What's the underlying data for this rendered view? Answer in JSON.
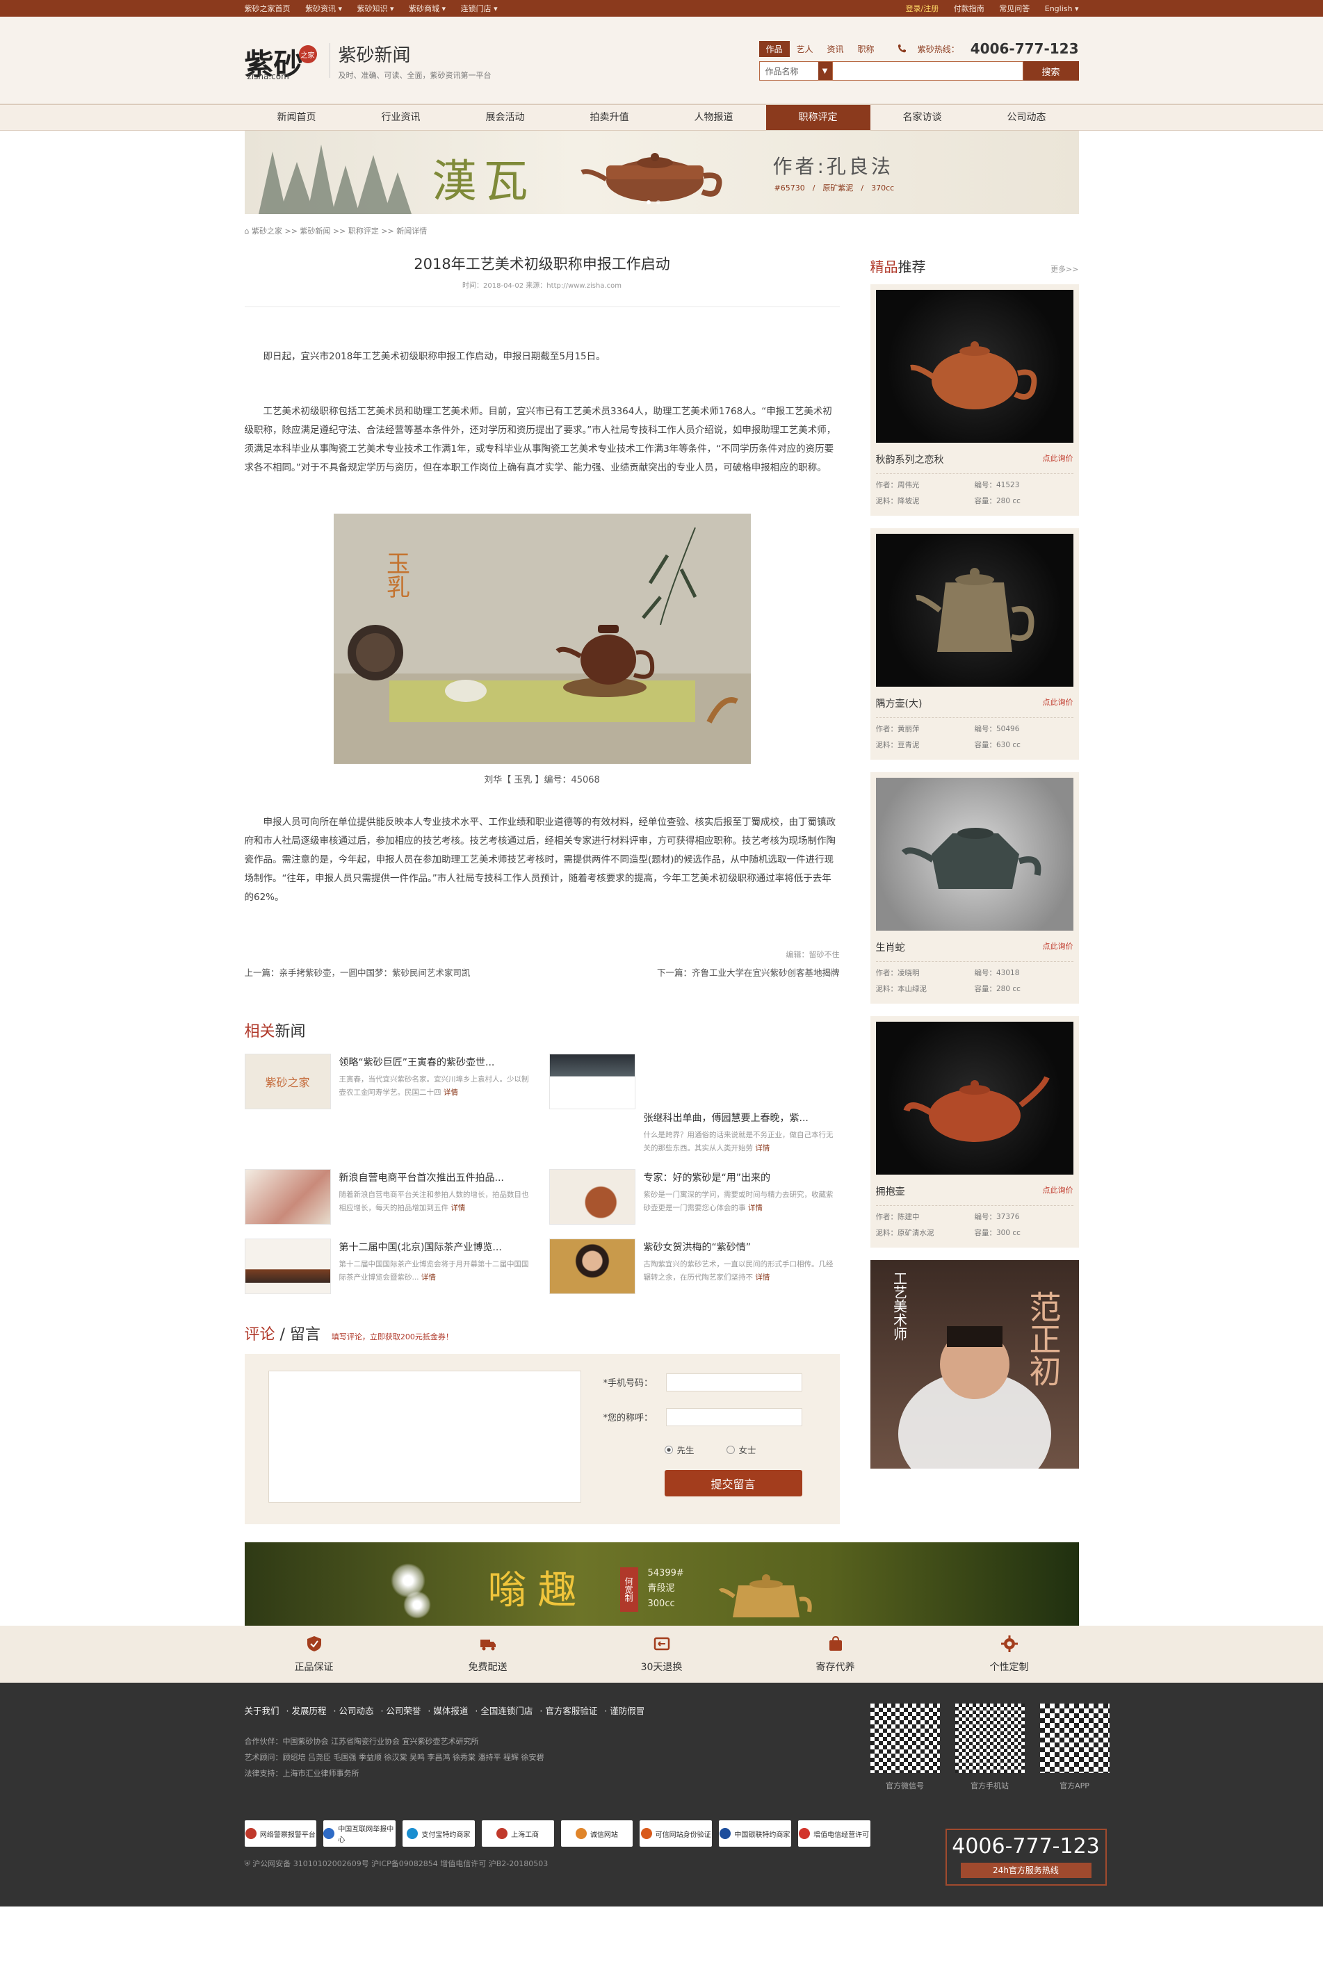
{
  "topbar": {
    "left": [
      "紫砂之家首页",
      "紫砂资讯 ▾",
      "紫砂知识 ▾",
      "紫砂商城 ▾",
      "连锁门店 ▾"
    ],
    "right": [
      "登录/注册",
      "付款指南",
      "常见问答",
      "English ▾"
    ]
  },
  "header": {
    "logo_char": "紫砂",
    "logo_seal": "之家",
    "logo_domain": "zisha.com",
    "site_title": "紫砂新闻",
    "site_sub": "及时、准确、可读、全面，紫砂资讯第一平台",
    "search_tabs": [
      "作品",
      "艺人",
      "资讯",
      "职称"
    ],
    "hotline_label": "紫砂热线：",
    "hotline": "4006-777-123",
    "select_value": "作品名称",
    "search_button": "搜索"
  },
  "nav": [
    "新闻首页",
    "行业资讯",
    "展会活动",
    "拍卖升值",
    "人物报道",
    "职称评定",
    "名家访谈",
    "公司动态"
  ],
  "banner": {
    "title": "漢瓦",
    "author": "作者:孔良法",
    "meta": "#65730　/　原矿紫泥　/　370cc"
  },
  "breadcrumb": "紫砂之家 >> 紫砂新闻 >> 职称评定 >> 新闻详情",
  "article": {
    "title": "2018年工艺美术初级职称申报工作启动",
    "meta": "时间：2018-04-02 来源：http://www.zisha.com",
    "p1": "即日起，宜兴市2018年工艺美术初级职称申报工作启动，申报日期截至5月15日。",
    "p2": "工艺美术初级职称包括工艺美术员和助理工艺美术师。目前，宜兴市已有工艺美术员3364人，助理工艺美术师1768人。“申报工艺美术初级职称，除应满足遵纪守法、合法经营等基本条件外，还对学历和资历提出了要求。”市人社局专技科工作人员介绍说，如申报助理工艺美术师，须满足本科毕业从事陶瓷工艺美术专业技术工作满1年，或专科毕业从事陶瓷工艺美术专业技术工作满3年等条件，“不同学历条件对应的资历要求各不相同。”对于不具备规定学历与资历，但在本职工作岗位上确有真才实学、能力强、业绩贡献突出的专业人员，可破格申报相应的职称。",
    "figure_caption": "刘华【 玉乳 】编号：45068",
    "figure_text": "玉乳",
    "p3": "申报人员可向所在单位提供能反映本人专业技术水平、工作业绩和职业道德等的有效材料，经单位查验、核实后报至丁蜀成校，由丁蜀镇政府和市人社局逐级审核通过后，参加相应的技艺考核。技艺考核通过后，经相关专家进行材料评审，方可获得相应职称。技艺考核为现场制作陶瓷作品。需注意的是，今年起，申报人员在参加助理工艺美术师技艺考核时，需提供两件不同造型(题材)的候选作品，从中随机选取一件进行现场制作。“往年，申报人员只需提供一件作品。”市人社局专技科工作人员预计，随着考核要求的提高，今年工艺美术初级职称通过率将低于去年的62%。",
    "editor": "编辑：留砂不住",
    "prev": "上一篇：亲手拷紫砂壶，一圆中国梦：紫砂民间艺术家司凯",
    "next": "下一篇：齐鲁工业大学在宜兴紫砂创客基地揭牌"
  },
  "related": {
    "title_em": "相关",
    "title_rest": "新闻",
    "more_label": "详情",
    "items": [
      {
        "title": "领略“紫砂巨匠”王寅春的紫砂壶世...",
        "desc": "王寅春，当代宜兴紫砂名家。宜兴川埠乡上袁村人。少以制壶农工金阿寿学艺。民国二十四",
        "thumb": "紫砂之家"
      },
      {
        "title": "张继科出单曲，傅园慧要上春晚，紫...",
        "desc": "什么是跨界？用通俗的话来说就是不务正业，做自己本行无关的那些东西。其实从人类开始劳",
        "thumb": ""
      },
      {
        "title": "新浪自营电商平台首次推出五件拍品...",
        "desc": "随着新浪自营电商平台关注和参拍人数的增长，拍品数目也相应增长，每天的拍品增加到五件",
        "thumb": ""
      },
      {
        "title": "专家：好的紫砂是“用”出来的",
        "desc": "紫砂是一门寓深的学问，需要或时间与精力去研究，收藏紫砂壶更是一门需要您心体会的事",
        "thumb": ""
      },
      {
        "title": "第十二届中国(北京)国际茶产业博览...",
        "desc": "第十二届中国国际茶产业博览会将于月开幕第十二届中国国际茶产业博览会暨紫砂...",
        "thumb": ""
      },
      {
        "title": "紫砂女贺洪梅的“紫砂情”",
        "desc": "古陶紫宜兴的紫砂艺术，一直以民间的形式手口相传。几经辗转之余，在历代陶艺家们坚持不",
        "thumb": ""
      }
    ]
  },
  "comment": {
    "title_em": "评论",
    "title_rest": " / 留言",
    "subtitle": "填写评论，立即获取200元抵金券！",
    "phone_label": "*手机号码：",
    "name_label": "*您的称呼：",
    "male": "先生",
    "female": "女士",
    "submit": "提交留言"
  },
  "sidebar": {
    "title_em": "精品",
    "title_rest": "推荐",
    "more": "更多>>",
    "products": [
      {
        "name": "秋韵系列之恋秋",
        "price": "点此询价",
        "author": "作者：周伟光",
        "code": "编号：41523",
        "clay": "泥料：降坡泥",
        "volume": "容量：280 cc",
        "color": "#b55a2f"
      },
      {
        "name": "隅方壶(大)",
        "price": "点此询价",
        "author": "作者：黄丽萍",
        "code": "编号：50496",
        "clay": "泥料：豆青泥",
        "volume": "容量：630 cc",
        "color": "#8a7a5c"
      },
      {
        "name": "生肖蛇",
        "price": "点此询价",
        "author": "作者：凌晓明",
        "code": "编号：43018",
        "clay": "泥料：本山绿泥",
        "volume": "容量：280 cc",
        "color": "#3e4a48"
      },
      {
        "name": "拥抱壶",
        "price": "点此询价",
        "author": "作者：陈建中",
        "code": "编号：37376",
        "clay": "泥料：原矿清水泥",
        "volume": "容量：300 cc",
        "color": "#b24a28"
      }
    ],
    "ad_title": "范正初",
    "ad_sub": "工艺美术师"
  },
  "bottom_ad": {
    "title": "嗡趣",
    "tag": "何宽制",
    "code": "54399#",
    "clay": "青段泥",
    "volume": "300cc"
  },
  "services": [
    "正品保证",
    "免费配送",
    "30天退换",
    "寄存代养",
    "个性定制"
  ],
  "footer": {
    "links": [
      "关于我们",
      "发展历程",
      "公司动态",
      "公司荣誉",
      "媒体报道",
      "全国连锁门店",
      "官方客服验证",
      "谨防假冒"
    ],
    "partners": "合作伙伴：中国紫砂协会 江苏省陶瓷行业协会 宜兴紫砂壶艺术研究所",
    "advisors": "艺术顾问：顾绍培 吕尧臣 毛国强 季益顺 徐汉棠 吴鸣 李昌鸿 徐秀棠 潘持平 程辉 徐安碧",
    "legal": "法律支持：上海市汇业律师事务所",
    "qrs": [
      "官方微信号",
      "官方手机站",
      "官方APP"
    ],
    "badges": [
      "网络警察报警平台",
      "中国互联网举报中心",
      "支付宝特约商家",
      "上海工商",
      "诚信网站",
      "可信网站身份验证",
      "中国银联特约商家",
      "增值电信经营许可"
    ],
    "icp": "沪公网安备 31010102002609号 沪ICP备09082854 增值电信许可 沪B2-20180503",
    "hotline": "4006-777-123",
    "hotline_label": "24h官方服务热线"
  }
}
